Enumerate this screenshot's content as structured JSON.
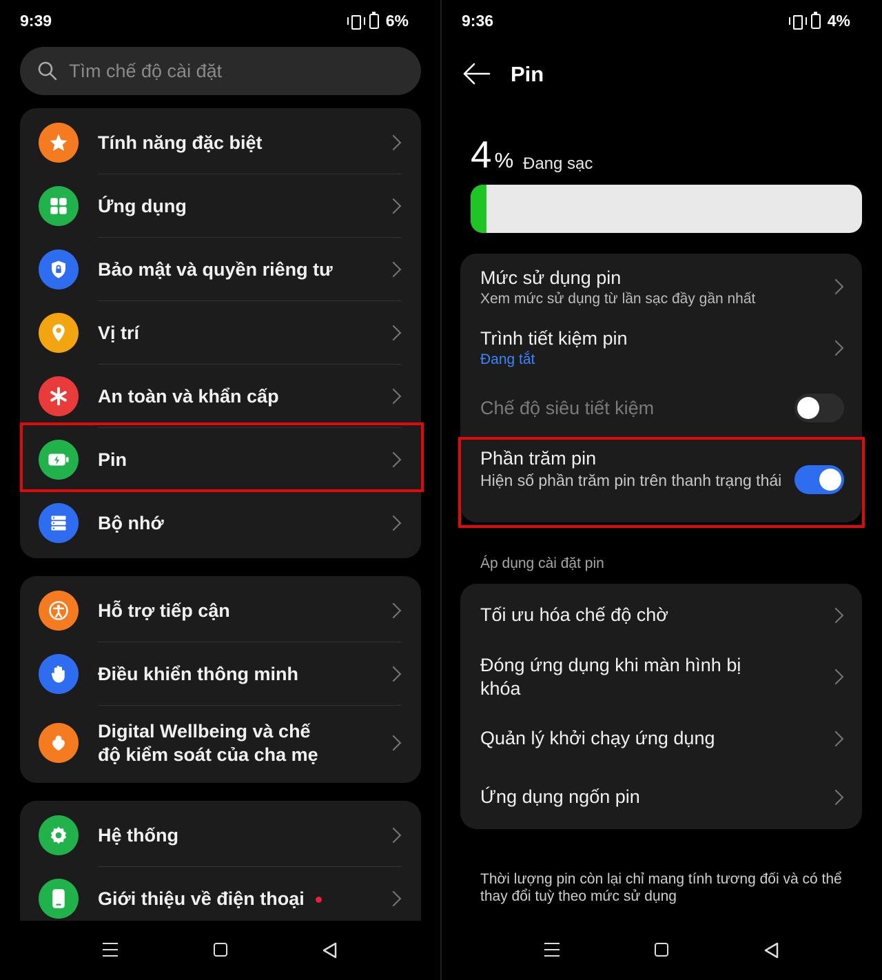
{
  "left": {
    "status": {
      "time": "9:39",
      "battery_text": "6%"
    },
    "search": {
      "placeholder": "Tìm chế độ cài đặt"
    },
    "groups": [
      {
        "items": [
          {
            "label": "Tính năng đặc biệt",
            "icon": "star-icon",
            "color": "#f47b20"
          },
          {
            "label": "Ứng dụng",
            "icon": "apps-grid-icon",
            "color": "#21b24b"
          },
          {
            "label": "Bảo mật và quyền riêng tư",
            "icon": "shield-lock-icon",
            "color": "#2f6df0"
          },
          {
            "label": "Vị trí",
            "icon": "location-pin-icon",
            "color": "#f2a511"
          },
          {
            "label": "An toàn và khẩn cấp",
            "icon": "asterisk-icon",
            "color": "#ea3b3b"
          },
          {
            "label": "Pin",
            "icon": "battery-charging-icon",
            "color": "#21b24b"
          },
          {
            "label": "Bộ nhớ",
            "icon": "storage-icon",
            "color": "#2f6df0"
          }
        ]
      },
      {
        "items": [
          {
            "label": "Hỗ trợ tiếp cận",
            "icon": "accessibility-icon",
            "color": "#f47b20"
          },
          {
            "label": "Điều khiển thông minh",
            "icon": "hand-icon",
            "color": "#2f6df0"
          },
          {
            "label": "Digital Wellbeing và chế độ kiểm soát của cha mẹ",
            "icon": "wellbeing-icon",
            "color": "#f47b20"
          }
        ]
      },
      {
        "items": [
          {
            "label": "Hệ thống",
            "icon": "gear-icon",
            "color": "#21b24b"
          },
          {
            "label": "Giới thiệu về điện thoại",
            "icon": "phone-icon",
            "color": "#21b24b"
          }
        ]
      }
    ]
  },
  "right": {
    "status": {
      "time": "9:36",
      "battery_text": "4%"
    },
    "title": "Pin",
    "battery": {
      "percent_value": "4",
      "percent_sign": "%",
      "state": "Đang sạc",
      "level_fraction": 0.04
    },
    "group1": {
      "usage": {
        "title": "Mức sử dụng pin",
        "subtitle": "Xem mức sử dụng từ lần sạc đầy gần nhất"
      },
      "saver": {
        "title": "Trình tiết kiệm pin",
        "subtitle": "Đang tắt"
      },
      "ultra": {
        "title": "Chế độ siêu tiết kiệm",
        "enabled": false
      },
      "percentage": {
        "title": "Phần trăm pin",
        "subtitle": "Hiện số phần trăm pin trên thanh trạng thái",
        "enabled": true
      }
    },
    "section_header": "Áp dụng cài đặt pin",
    "group2": [
      {
        "label": "Tối ưu hóa chế độ chờ"
      },
      {
        "label": "Đóng ứng dụng khi màn hình bị khóa"
      },
      {
        "label": "Quản lý khởi chạy ứng dụng"
      },
      {
        "label": "Ứng dụng ngốn pin"
      }
    ],
    "footnote": "Thời lượng pin còn lại chỉ mang tính tương đối và có thể thay đổi tuỳ theo mức sử dụng"
  },
  "colors": {
    "highlight": "#e10a0a",
    "accent_blue": "#2f6df0",
    "battery_fill": "#1ec524"
  }
}
